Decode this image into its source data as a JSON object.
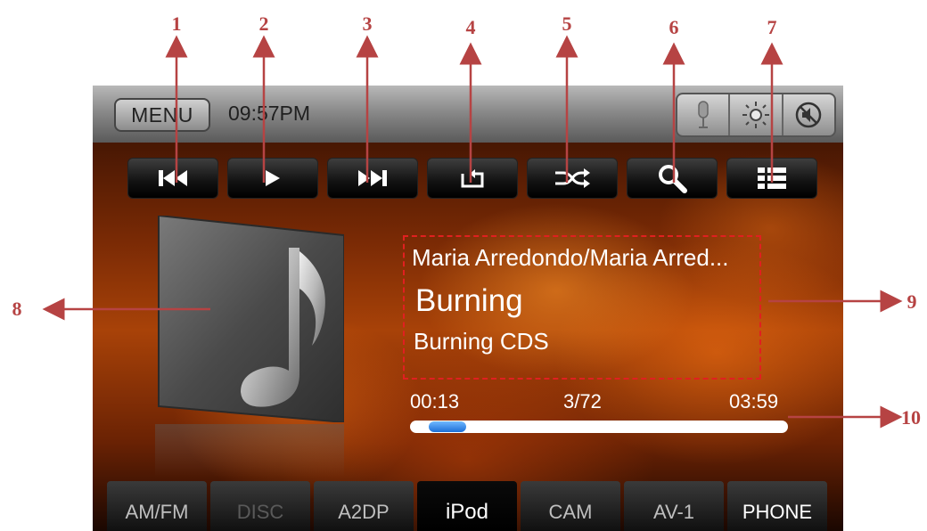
{
  "callouts": [
    "1",
    "2",
    "3",
    "4",
    "5",
    "6",
    "7",
    "8",
    "9",
    "10"
  ],
  "status_bar": {
    "menu_label": "MENU",
    "time": "09:57PM"
  },
  "system_icons": [
    "microphone-icon",
    "brightness-icon",
    "mute-icon"
  ],
  "controls": [
    "previous-track",
    "play",
    "next-track",
    "repeat",
    "shuffle",
    "search",
    "list"
  ],
  "track": {
    "artist": "Maria Arredondo/Maria Arred...",
    "title": "Burning",
    "album": "Burning CDS",
    "elapsed": "00:13",
    "track_position": "3/72",
    "duration": "03:59",
    "progress_fraction": 0.054
  },
  "source_tabs": [
    {
      "label": "AM/FM",
      "state": "normal"
    },
    {
      "label": "DISC",
      "state": "disabled"
    },
    {
      "label": "A2DP",
      "state": "normal"
    },
    {
      "label": "iPod",
      "state": "active"
    },
    {
      "label": "CAM",
      "state": "normal"
    },
    {
      "label": "AV-1",
      "state": "normal"
    },
    {
      "label": "PHONE",
      "state": "bright"
    }
  ],
  "colors": {
    "callout": "#b64343",
    "info_box_border": "#e02020",
    "progress_knob": "#1b6fd6"
  }
}
